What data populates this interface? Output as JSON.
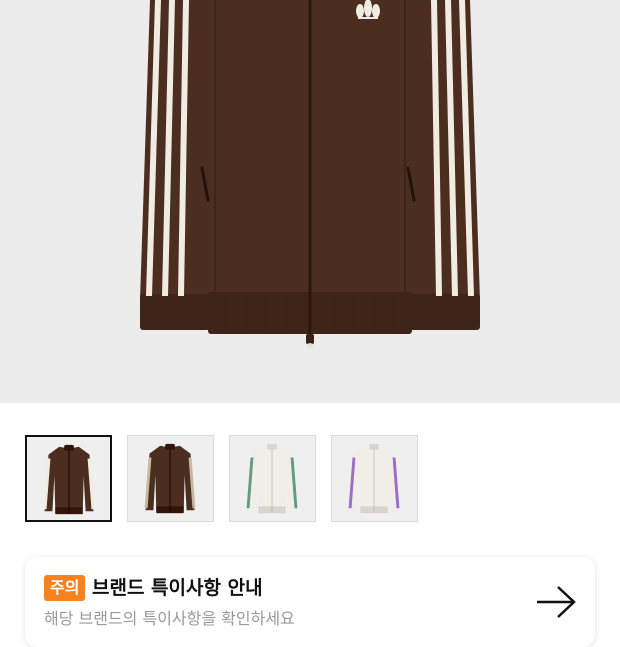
{
  "product": {
    "main_image": {
      "icon": "track-jacket-image",
      "body_color": "#4b2e20",
      "stripe_color": "#f1ece2"
    }
  },
  "thumbnails": [
    {
      "icon": "track-jacket-thumbnail",
      "selected": true,
      "body_color": "#4b2e20",
      "stripe_color": "#f1ece2"
    },
    {
      "icon": "track-jacket-thumbnail",
      "selected": false,
      "body_color": "#4b2e20",
      "stripe_color": "#c9b8a0"
    },
    {
      "icon": "track-jacket-thumbnail",
      "selected": false,
      "body_color": "#f1eee7",
      "stripe_color": "#5f9d80"
    },
    {
      "icon": "track-jacket-thumbnail",
      "selected": false,
      "body_color": "#f1eee7",
      "stripe_color": "#9b6fc6"
    }
  ],
  "notice": {
    "badge": "주의",
    "title": "브랜드 특이사항 안내",
    "subtitle": "해당 브랜드의 특이사항을 확인하세요",
    "badge_color": "#f58220",
    "arrow_icon": "arrow-right-icon"
  }
}
